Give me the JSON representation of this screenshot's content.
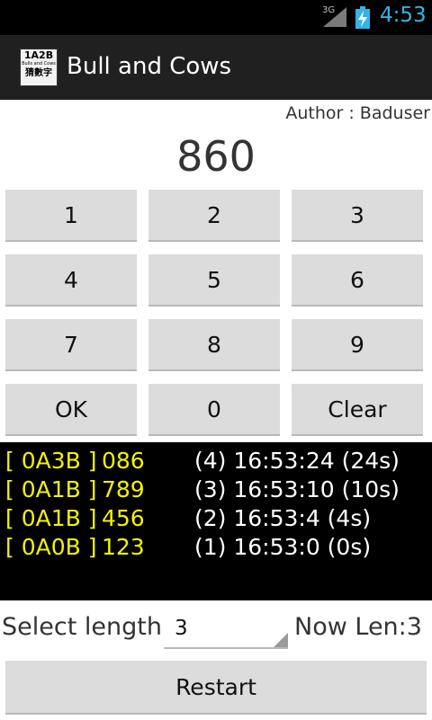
{
  "status_bar": {
    "network_label": "3G",
    "signal_icon": "signal-icon",
    "battery_icon": "battery-charging-icon",
    "time": "4:53"
  },
  "action_bar": {
    "icon": {
      "line1": "1A2B",
      "line2": "Bulls and Cows",
      "line3": "猜數字"
    },
    "title": "Bull and Cows"
  },
  "author": "Author : Baduser",
  "display": {
    "current_input": "860"
  },
  "keypad": {
    "keys": [
      "1",
      "2",
      "3",
      "4",
      "5",
      "6",
      "7",
      "8",
      "9",
      "OK",
      "0",
      "Clear"
    ]
  },
  "history": [
    {
      "result": "[ 0A3B ]",
      "guess": "086",
      "info": "(4) 16:53:24 (24s)"
    },
    {
      "result": "[ 0A1B ]",
      "guess": "789",
      "info": "(3) 16:53:10 (10s)"
    },
    {
      "result": "[ 0A1B ]",
      "guess": "456",
      "info": "(2) 16:53:4 (4s)"
    },
    {
      "result": "[ 0A0B ]",
      "guess": "123",
      "info": "(1) 16:53:0 (0s)"
    }
  ],
  "settings": {
    "select_label": "Select length",
    "selected_length": "3",
    "now_len": "Now Len:3"
  },
  "restart_label": "Restart",
  "colors": {
    "accent_blue": "#33b5e5",
    "result_yellow": "#f2f20a",
    "key_bg": "#dcdcdc"
  }
}
